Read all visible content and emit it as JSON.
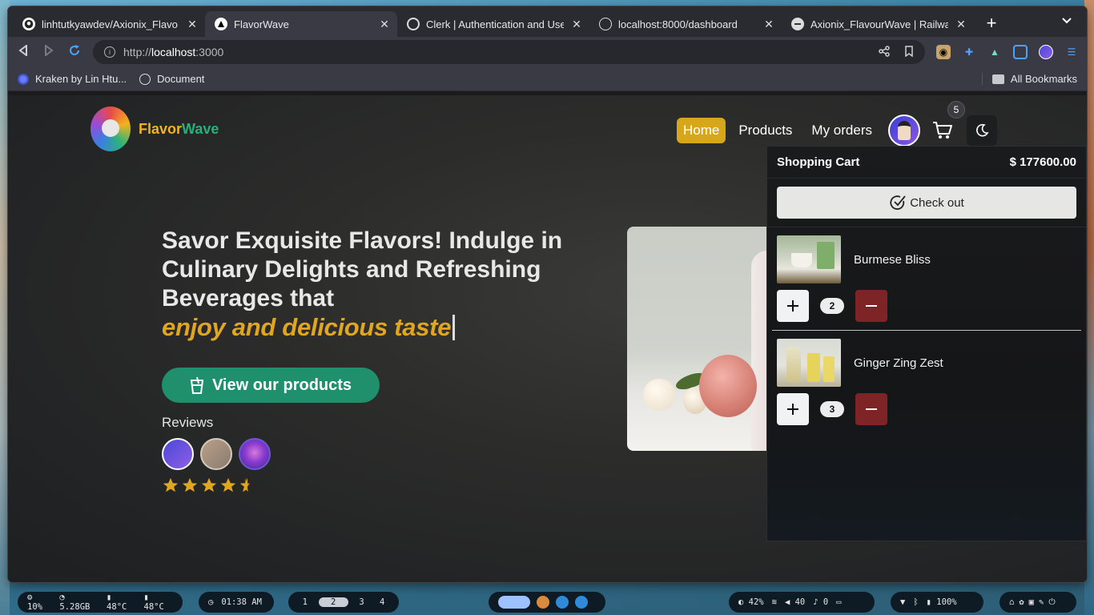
{
  "browser": {
    "tabs": [
      {
        "title": "linhtutkyawdev/Axionix_Flavo",
        "icon": "github-icon",
        "active": false
      },
      {
        "title": "FlavorWave",
        "icon": "vercel-triangle-icon",
        "active": true
      },
      {
        "title": "Clerk | Authentication and Use",
        "icon": "clerk-icon",
        "active": false
      },
      {
        "title": "localhost:8000/dashboard",
        "icon": "globe-icon",
        "active": false
      },
      {
        "title": "Axionix_FlavourWave | Railwa",
        "icon": "railway-icon",
        "active": false
      }
    ],
    "url_scheme": "http://",
    "url_host": "localhost",
    "url_port": ":3000",
    "bookmarks": [
      {
        "label": "Kraken by Lin Htu...",
        "icon": "kraken-icon"
      },
      {
        "label": "Document",
        "icon": "globe-icon"
      }
    ],
    "all_bookmarks": "All Bookmarks"
  },
  "site": {
    "brand_part1": "Flavor",
    "brand_part2": "Wave",
    "nav": {
      "home": "Home",
      "products": "Products",
      "orders": "My orders"
    },
    "cart_count": "5",
    "hero": {
      "headline": "Savor Exquisite Flavors! Indulge in Culinary Delights and Refreshing Beverages that",
      "accent": "enjoy and delicious taste"
    },
    "cta_label": "View our products",
    "reviews_label": "Reviews",
    "rating": 4.5
  },
  "cart": {
    "title": "Shopping Cart",
    "total": "$ 177600.00",
    "checkout_label": "Check out",
    "items": [
      {
        "name": "Burmese Bliss",
        "qty": "2"
      },
      {
        "name": "Ginger Zing Zest",
        "qty": "3"
      }
    ]
  },
  "taskbar": {
    "cpu": "10%",
    "mem": "5.28GB",
    "temp1": "48°C",
    "temp2": "48°C",
    "clock": "01:38 AM",
    "workspaces": [
      "1",
      "2",
      "3",
      "4"
    ],
    "active_workspace": "2",
    "brightness": "42%",
    "volume": "40",
    "mic": "0",
    "battery": "100%"
  },
  "colors": {
    "accent_yellow": "#d7a71b",
    "accent_green": "#1f8f6c",
    "minus_red": "#7e2427"
  }
}
